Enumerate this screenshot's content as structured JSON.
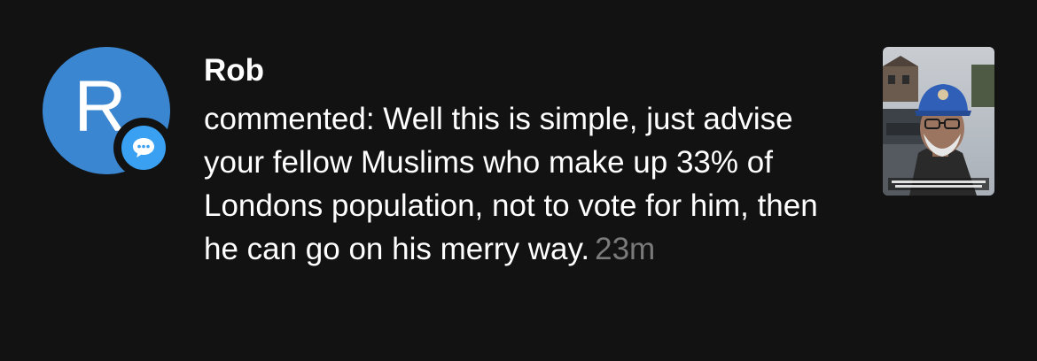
{
  "notification": {
    "avatar_letter": "R",
    "avatar_color": "#3b86d0",
    "badge_icon": "comment-bubble-icon",
    "badge_color": "#3aa0f2",
    "username": "Rob",
    "comment_text": "commented: Well this is simple, just advise your fellow Muslims who make up 33% of Londons population, not to vote for him, then he can go on his merry way.",
    "timestamp": "23m",
    "thumbnail_icon": "video-thumbnail"
  }
}
